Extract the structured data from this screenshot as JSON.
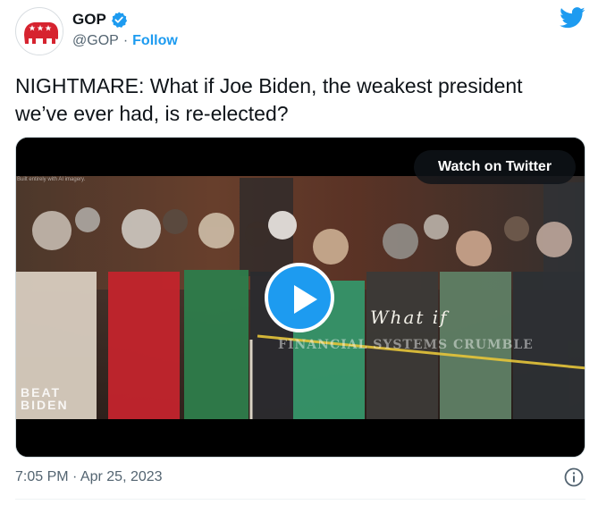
{
  "author": {
    "name": "GOP",
    "handle": "@GOP",
    "separator": "·",
    "follow_label": "Follow"
  },
  "tweet": {
    "text": "NIGHTMARE: What if Joe Biden, the weakest president we’ve ever had, is re-elected?"
  },
  "media": {
    "watch_label": "Watch on Twitter",
    "overlay_small": "Built entirely with AI imagery.",
    "overlay_what_if": "What if",
    "overlay_caption": "FINANCIAL SYSTEMS CRUMBLE",
    "overlay_logo_line1": "BEAT",
    "overlay_logo_line2": "BIDEN"
  },
  "footer": {
    "timestamp": "7:05 PM · Apr 25, 2023"
  },
  "icons": {
    "avatar": "gop-elephant-logo",
    "verified": "verified-badge-icon",
    "brand": "twitter-bird-icon",
    "info": "info-icon",
    "play": "play-icon"
  },
  "colors": {
    "link_blue": "#1d9bf0",
    "muted": "#536471",
    "text": "#0f1419",
    "gop_red": "#d6232f"
  }
}
